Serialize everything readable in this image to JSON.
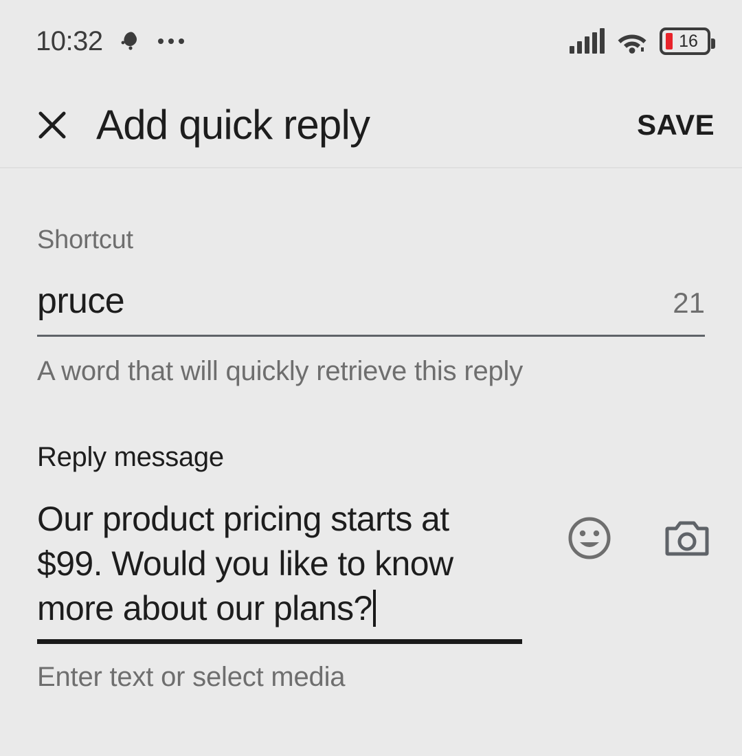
{
  "status_bar": {
    "time": "10:32",
    "notification_icon": "app-notification-blob-icon",
    "overflow_icon": "more-notifications-ellipsis-icon",
    "signal_icon": "cellular-signal-icon",
    "wifi_icon": "wifi-icon",
    "battery_icon": "battery-icon",
    "battery_level": "16",
    "battery_low_color": "#e8232a"
  },
  "app_bar": {
    "close_icon": "close-icon",
    "title": "Add quick reply",
    "save_label": "SAVE"
  },
  "form": {
    "shortcut": {
      "label": "Shortcut",
      "value": "pruce",
      "counter": "21",
      "helper": "A word that will quickly retrieve this reply"
    },
    "reply_message": {
      "label": "Reply message",
      "value": "Our product pricing starts at $99. Would you like to know more about our plans?",
      "helper": "Enter text or select media",
      "emoji_icon": "emoji-smiley-icon",
      "camera_icon": "camera-icon"
    }
  },
  "colors": {
    "background": "#eaeaea",
    "text_primary": "#1d1d1d",
    "text_secondary": "#6e6e6e",
    "underline_focused": "#1a1a1a",
    "underline_default": "#5f6368"
  }
}
